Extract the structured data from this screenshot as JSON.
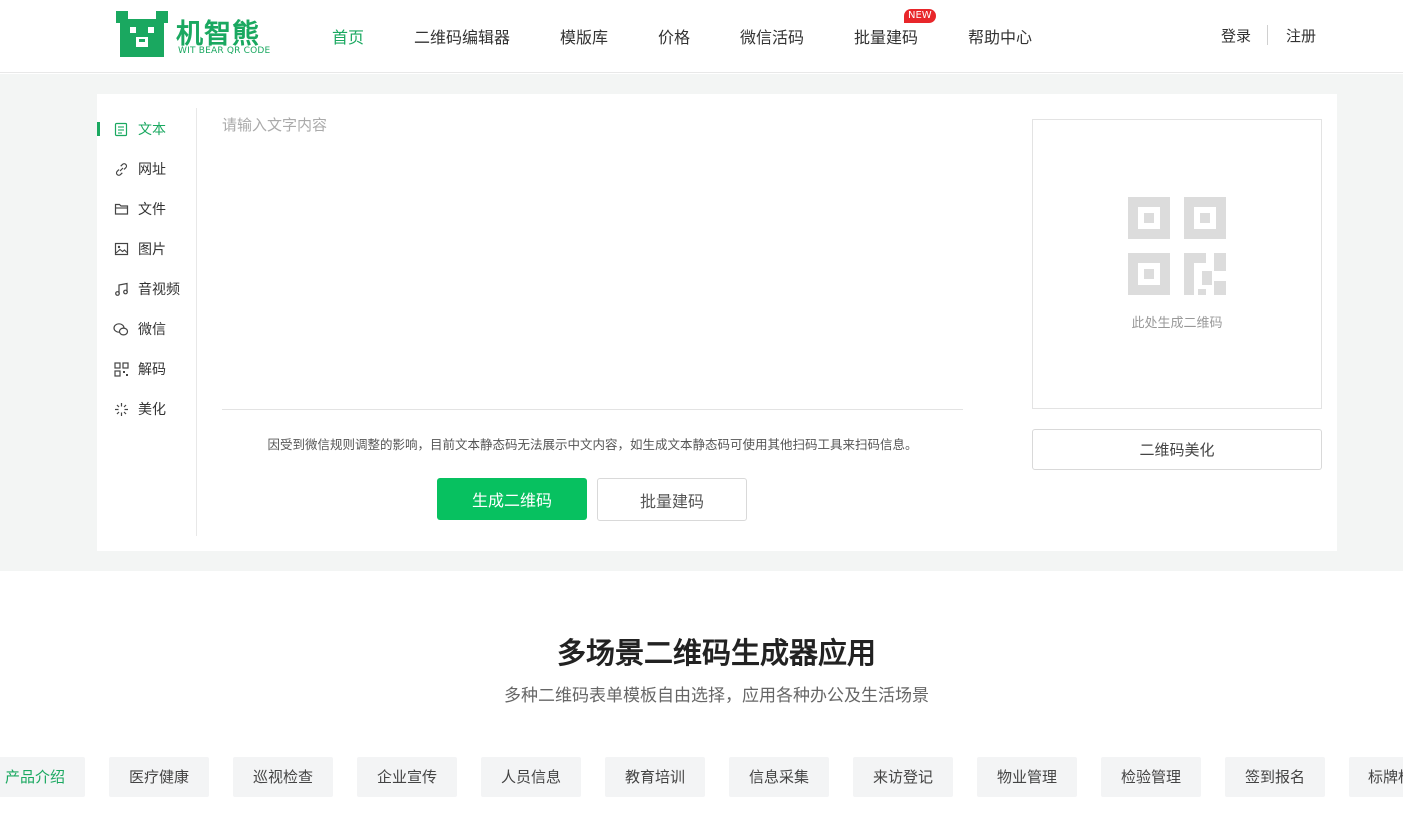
{
  "brand": {
    "name_cn": "机智熊",
    "name_en": "WIT BEAR QR CODE",
    "accent": "#1aa860",
    "button_green": "#07c160",
    "badge_red": "#e8262a"
  },
  "nav": {
    "items": [
      {
        "label": "首页",
        "active": true
      },
      {
        "label": "二维码编辑器"
      },
      {
        "label": "模版库"
      },
      {
        "label": "价格"
      },
      {
        "label": "微信活码"
      },
      {
        "label": "批量建码",
        "badge": "NEW"
      },
      {
        "label": "帮助中心"
      }
    ],
    "login": "登录",
    "register": "注册"
  },
  "sidebar": {
    "items": [
      {
        "label": "文本",
        "icon": "document-icon",
        "active": true
      },
      {
        "label": "网址",
        "icon": "link-icon"
      },
      {
        "label": "文件",
        "icon": "folder-icon"
      },
      {
        "label": "图片",
        "icon": "image-icon"
      },
      {
        "label": "音视频",
        "icon": "music-icon"
      },
      {
        "label": "微信",
        "icon": "wechat-icon"
      },
      {
        "label": "解码",
        "icon": "qr-scan-icon"
      },
      {
        "label": "美化",
        "icon": "sparkle-icon"
      }
    ]
  },
  "editor": {
    "placeholder": "请输入文字内容",
    "value": "",
    "notice": "因受到微信规则调整的影响，目前文本静态码无法展示中文内容，如生成文本静态码可使用其他扫码工具来扫码信息。",
    "generate_label": "生成二维码",
    "batch_label": "批量建码"
  },
  "preview": {
    "caption": "此处生成二维码",
    "beautify_label": "二维码美化"
  },
  "scenes": {
    "title": "多场景二维码生成器应用",
    "subtitle": "多种二维码表单模板自由选择，应用各种办公及生活场景",
    "tabs": [
      {
        "label": "产品介绍",
        "active": true
      },
      {
        "label": "医疗健康"
      },
      {
        "label": "巡视检查"
      },
      {
        "label": "企业宣传"
      },
      {
        "label": "人员信息"
      },
      {
        "label": "教育培训"
      },
      {
        "label": "信息采集"
      },
      {
        "label": "来访登记"
      },
      {
        "label": "物业管理"
      },
      {
        "label": "检验管理"
      },
      {
        "label": "签到报名"
      },
      {
        "label": "标牌标"
      }
    ]
  }
}
